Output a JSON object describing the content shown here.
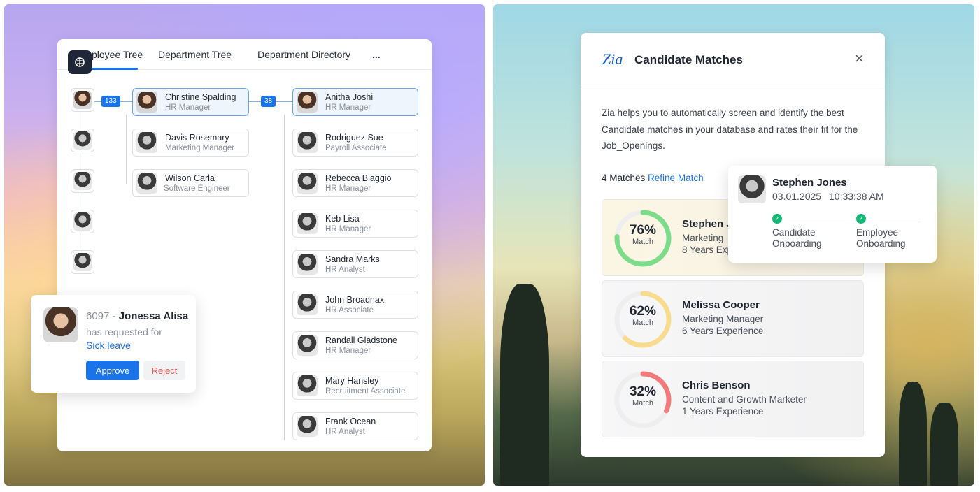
{
  "tree_card": {
    "tabs": [
      "Employee Tree",
      "Department Tree",
      "Department Directory",
      "..."
    ],
    "counts": {
      "first": "133",
      "second": "38"
    },
    "manager": {
      "name": "Christine Spalding",
      "role": "HR Manager"
    },
    "peers": [
      {
        "name": "Davis Rosemary",
        "role": "Marketing Manager"
      },
      {
        "name": "Wilson Carla",
        "role": "Software Engineer"
      }
    ],
    "reports": [
      {
        "name": "Anitha Joshi",
        "role": "HR Manager"
      },
      {
        "name": "Rodriguez Sue",
        "role": "Payroll Associate"
      },
      {
        "name": "Rebecca Biaggio",
        "role": "HR Manager"
      },
      {
        "name": "Keb Lisa",
        "role": "HR Manager"
      },
      {
        "name": "Sandra Marks",
        "role": "HR Analyst"
      },
      {
        "name": "John Broadnax",
        "role": "HR Associate"
      },
      {
        "name": "Randall Gladstone",
        "role": "HR Manager"
      },
      {
        "name": "Mary Hansley",
        "role": "Recruitment Associate"
      },
      {
        "name": "Frank Ocean",
        "role": "HR Analyst"
      }
    ]
  },
  "leave_request": {
    "id": "6097",
    "separator": " - ",
    "name": "Jonessa Alisa",
    "text": "has requested for",
    "leave_type": "Sick leave",
    "approve_label": "Approve",
    "reject_label": "Reject"
  },
  "candidate_card": {
    "logo": "Zia",
    "title": "Candidate Matches",
    "description": "Zia helps you to automatically screen and identify the best Candidate matches in your database and rates their fit for the Job_Openings.",
    "matches_count": "4 Matches",
    "refine_label": "Refine Match",
    "matches": [
      {
        "percent": 76,
        "percent_label": "76%",
        "match_label": "Match",
        "name": "Stephen J",
        "role": "Marketing",
        "experience": "8 Years Exp",
        "color": "#7ddc8a"
      },
      {
        "percent": 62,
        "percent_label": "62%",
        "match_label": "Match",
        "name": "Melissa Cooper",
        "role": "Marketing Manager",
        "experience": "6 Years Experience",
        "color": "#f7dc8f"
      },
      {
        "percent": 32,
        "percent_label": "32%",
        "match_label": "Match",
        "name": "Chris Benson",
        "role": "Content and Growth Marketer",
        "experience": "1 Years Experience",
        "color": "#f27a7a"
      }
    ]
  },
  "onboarding": {
    "name": "Stephen Jones",
    "date": "03.01.2025",
    "time": "10:33:38 AM",
    "steps": [
      {
        "line1": "Candidate",
        "line2": "Onboarding"
      },
      {
        "line1": "Employee",
        "line2": "Onboarding"
      }
    ]
  },
  "colors": {
    "accent": "#1a73e8",
    "success": "#16b877",
    "reject": "#e25858"
  }
}
